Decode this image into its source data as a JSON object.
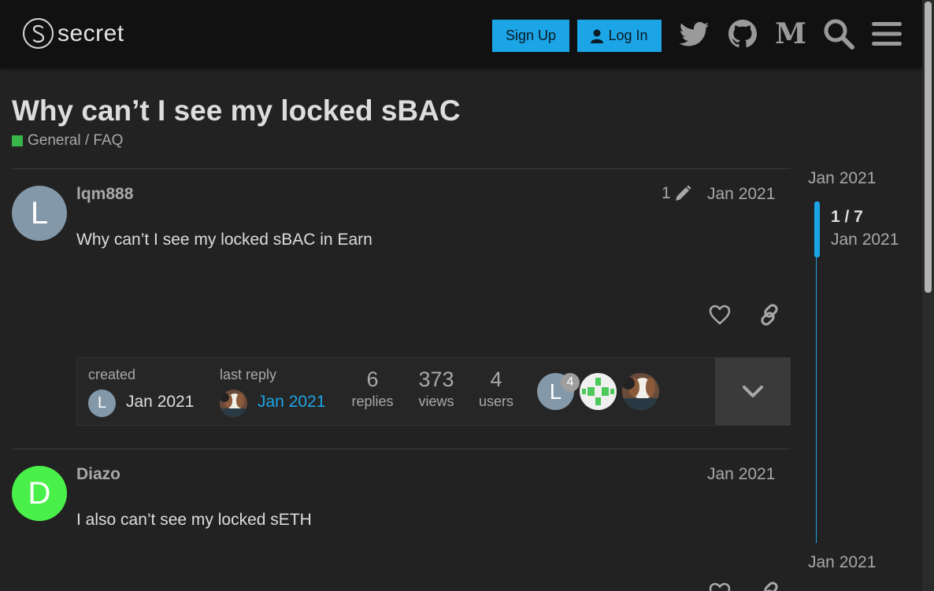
{
  "header": {
    "logo_text": "secret",
    "signup_label": "Sign Up",
    "login_label": "Log In",
    "icons": [
      "twitter-icon",
      "github-icon",
      "medium-icon",
      "search-icon",
      "hamburger-menu-icon"
    ]
  },
  "topic": {
    "title": "Why can’t I see my locked sBAC",
    "category": "General / FAQ",
    "category_color": "#3ab54a"
  },
  "posts": [
    {
      "avatar_letter": "L",
      "avatar_color": "#8398a8",
      "username": "lqm888",
      "date": "Jan 2021",
      "edit_count": "1",
      "body": "Why can’t I see my locked sBAC in Earn"
    },
    {
      "avatar_letter": "D",
      "avatar_color": "#4af04a",
      "username": "Diazo",
      "date": "Jan 2021",
      "body": "I also can’t see my locked sETH"
    }
  ],
  "topic_map": {
    "created_label": "created",
    "created_date": "Jan 2021",
    "last_reply_label": "last reply",
    "last_reply_date": "Jan 2021",
    "replies_count": "6",
    "replies_label": "replies",
    "views_count": "373",
    "views_label": "views",
    "users_count": "4",
    "users_label": "users",
    "participant_badge": "4",
    "participant_letter": "L"
  },
  "timeline": {
    "start_date": "Jan 2021",
    "position": "1 / 7",
    "position_date": "Jan 2021",
    "end_date": "Jan 2021"
  },
  "colors": {
    "accent": "#1ca5e6",
    "background": "#222222",
    "header": "#111111"
  }
}
